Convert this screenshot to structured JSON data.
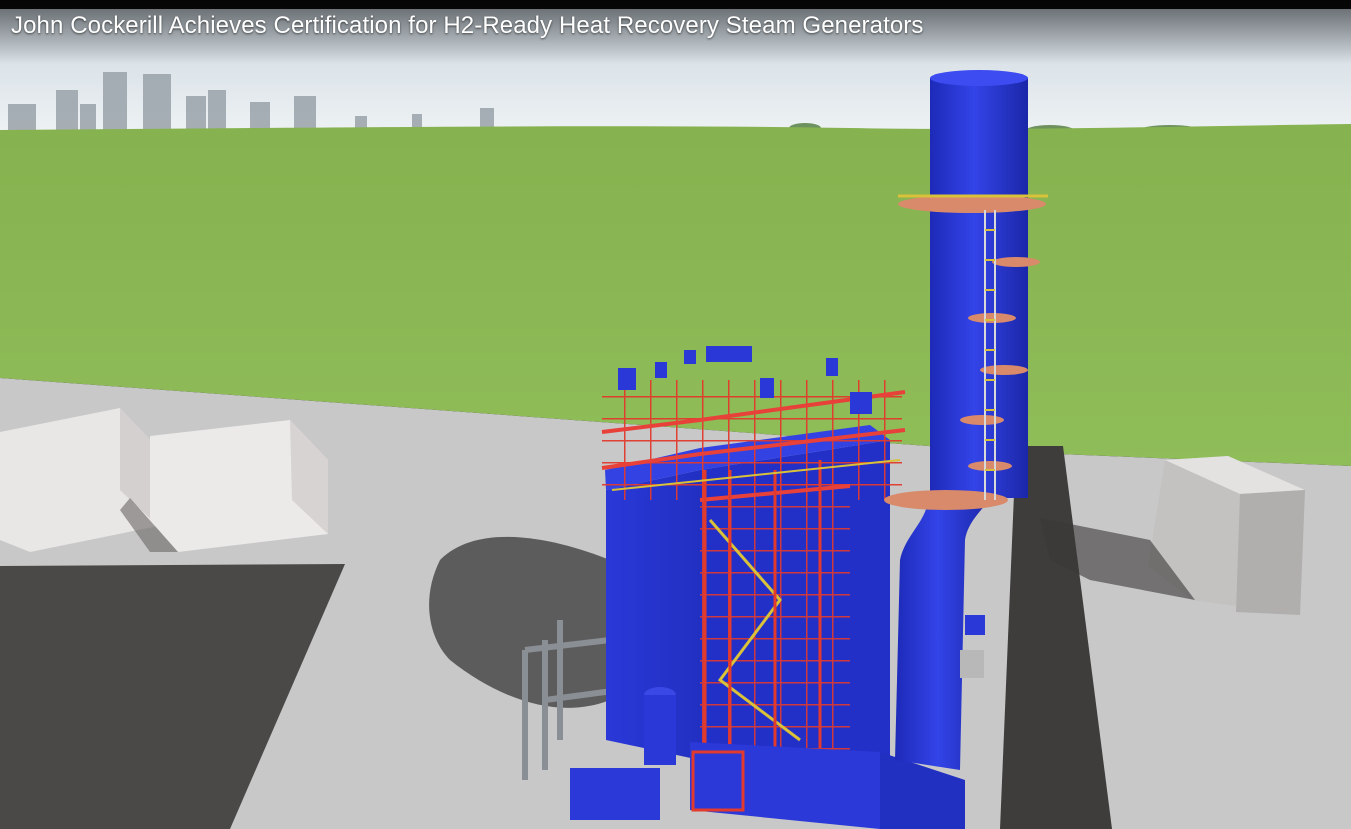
{
  "video": {
    "title": "John Cockerill Achieves Certification for H2-Ready Heat Recovery Steam Generators"
  },
  "colors": {
    "sky": "#e7eef3",
    "grass": "#86b54e",
    "ground": "#c9c9c9",
    "shadow": "#4a4747",
    "equipment_blue": "#2433d6",
    "steel_red": "#e23a2c",
    "railing_yellow": "#d9c23a",
    "platform": "#d98a6a"
  }
}
